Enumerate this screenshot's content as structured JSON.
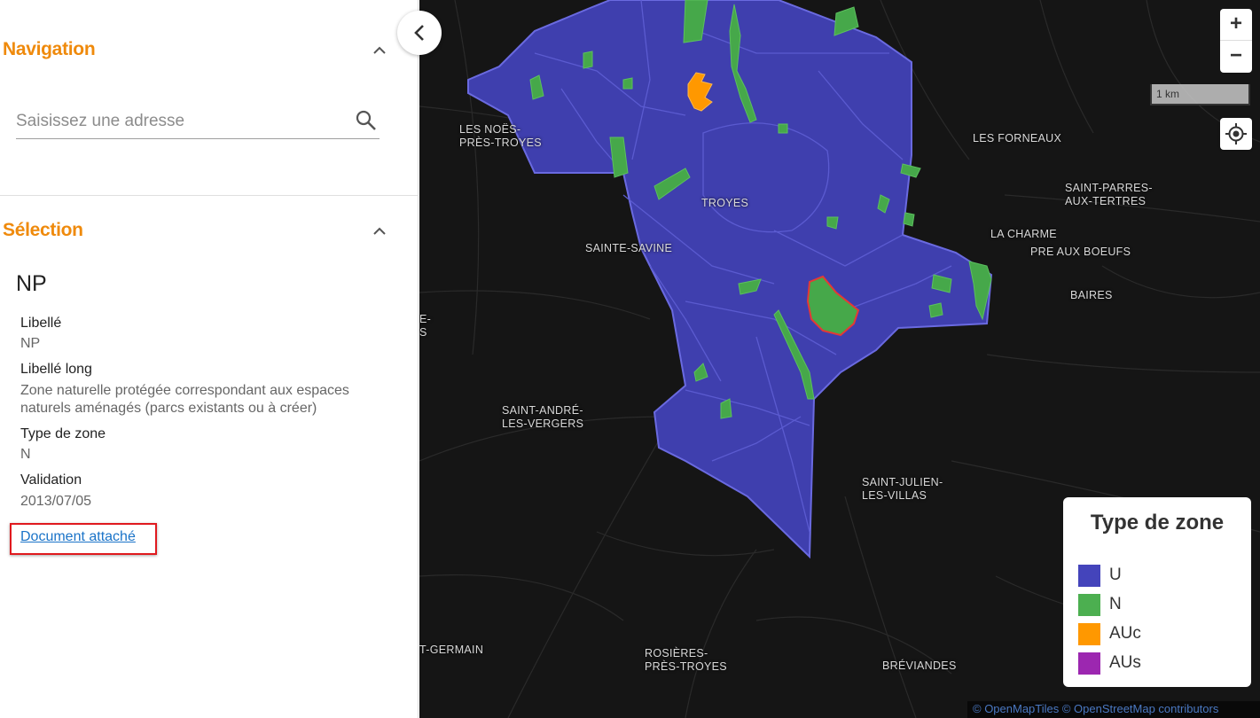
{
  "sidebar": {
    "navigation_title": "Navigation",
    "search_placeholder": "Saisissez une adresse",
    "selection_title": "Sélection",
    "feature": {
      "title": "NP",
      "attributes": [
        {
          "label": "Libellé",
          "value": "NP"
        },
        {
          "label": "Libellé long",
          "value": "Zone naturelle protégée correspondant aux espaces naturels aménagés (parcs existants ou à créer)"
        },
        {
          "label": "Type de zone",
          "value": "N"
        },
        {
          "label": "Validation",
          "value": "2013/07/05"
        }
      ],
      "document_link": "Document attaché"
    }
  },
  "map": {
    "places": [
      {
        "name": "LES NOËS-\nPRÈS-TROYES"
      },
      {
        "name": "TROYES"
      },
      {
        "name": "LES FORNEAUX"
      },
      {
        "name": "SAINT-PARRES-\nAUX-TERTRES"
      },
      {
        "name": "LA CHARME"
      },
      {
        "name": "PRE AUX BOEUFS"
      },
      {
        "name": "SAINTE-SAVINE"
      },
      {
        "name": "BAIRES"
      },
      {
        "name": "SAINT-ANDRÉ-\nLES-VERGERS"
      },
      {
        "name": "SAINT-JULIEN-\nLES-VILLAS"
      },
      {
        "name": "ROSIÈRES-\nPRÈS-TROYES"
      },
      {
        "name": "BRÉVIANDES"
      },
      {
        "name": "T-GERMAIN"
      },
      {
        "name": "E-\nS"
      }
    ],
    "controls": {
      "zoom_in": "+",
      "zoom_out": "−"
    },
    "scale_label": "1 km",
    "legend": {
      "title": "Type de zone",
      "items": [
        {
          "label": "U",
          "color": "#4444bb"
        },
        {
          "label": "N",
          "color": "#4caf50"
        },
        {
          "label": "AUc",
          "color": "#ff9800"
        },
        {
          "label": "AUs",
          "color": "#9c27b0"
        }
      ]
    },
    "attribution": "© OpenMapTiles © OpenStreetMap contributors"
  }
}
